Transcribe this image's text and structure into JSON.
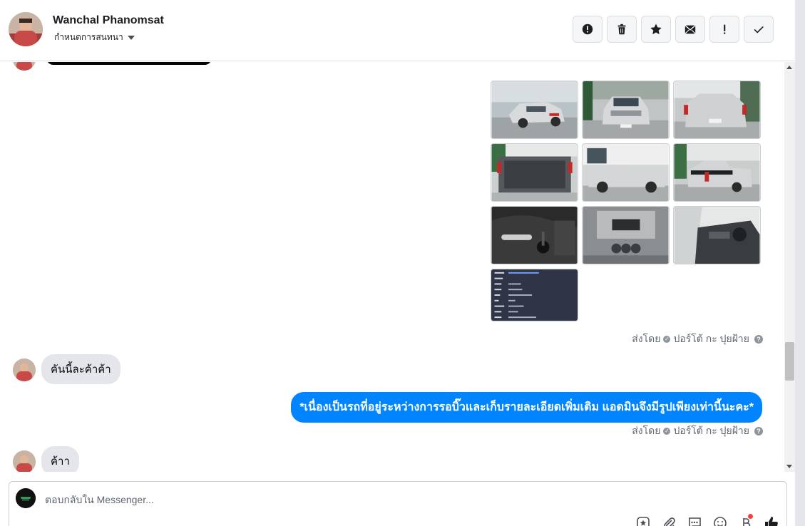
{
  "header": {
    "name": "Wanchal Phanomsat",
    "subtitle": "กำหนดการสนทนา",
    "actions": [
      {
        "icon": "alert-circle-icon",
        "name": "spam-button"
      },
      {
        "icon": "trash-icon",
        "name": "delete-button"
      },
      {
        "icon": "star-icon",
        "name": "star-button"
      },
      {
        "icon": "mark-unread-icon",
        "name": "mark-unread-button"
      },
      {
        "icon": "exclamation-icon",
        "name": "follow-up-button"
      },
      {
        "icon": "check-icon",
        "name": "done-button"
      }
    ]
  },
  "messages": {
    "sent_by_1": "ส่งโดย",
    "sender_1": "ปอร์โต้ กะ ปุยฝ้าย",
    "incoming_1": "คันนี้ละค้าค้า",
    "outgoing_1": "*เนื่องเป็นรถที่อยู่ระหว่างการรอบิ๊วและเก็บรายละเอียดเพิ่มเติม แอดมินจึงมีรูปเพียงเท่านี้นะคะ*",
    "sent_by_2": "ส่งโดย",
    "sender_2": "ปอร์โต้ กะ ปุยฝ้าย",
    "incoming_2": "ค้าา"
  },
  "composer": {
    "placeholder": "ตอบกลับใน Messenger...",
    "tools": [
      "sticker-star-icon",
      "attachment-icon",
      "saved-replies-icon",
      "emoji-icon",
      "baht-payment-icon",
      "thumbs-up-icon"
    ]
  },
  "colors": {
    "outgoing_bubble": "#0084ff",
    "incoming_bubble": "#e4e6eb",
    "notification_dot": "#fa3e3e"
  }
}
